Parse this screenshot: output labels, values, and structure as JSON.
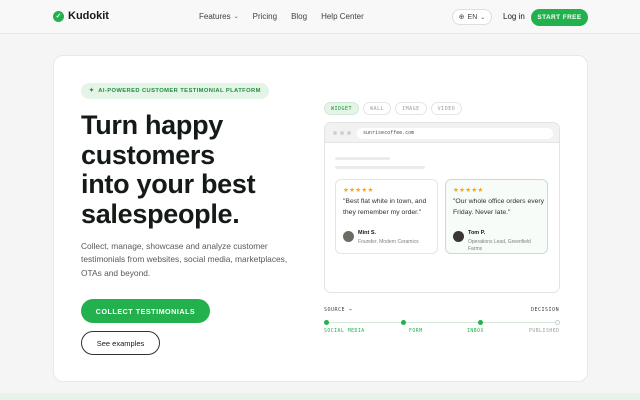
{
  "nav": {
    "logo": "Kudokit",
    "links": [
      "Features",
      "Pricing",
      "Blog",
      "Help Center"
    ],
    "lang": "EN",
    "login": "Log in",
    "start": "START FREE"
  },
  "hero": {
    "badge": "AI-POWERED CUSTOMER TESTIMONIAL PLATFORM",
    "headline": [
      "Turn happy",
      "customers",
      "into your best",
      "salespeople."
    ],
    "subtitle": "Collect, manage, showcase and analyze customer testimonials from websites, social media, marketplaces, OTAs and beyond.",
    "cta": "COLLECT TESTIMONIALS",
    "secondary": "See examples"
  },
  "preview": {
    "tabs": [
      "WIDGET",
      "WALL",
      "IMAGE",
      "VIDEO"
    ],
    "active_tab": "WIDGET",
    "url": "sunrisecoffee.com",
    "reviews": [
      {
        "stars": "★★★★★",
        "quote": "\"Best flat white in town, and they remember my order.\"",
        "name": "Mint S.",
        "role": "Founder, Modern Ceramics"
      },
      {
        "stars": "★★★★★",
        "quote": "\"Our whole office orders every Friday. Never late.\"",
        "name": "Tom P.",
        "role": "Operations Lead, Greenfield Farms"
      }
    ]
  },
  "flow": {
    "source": "SOURCE →",
    "decision": "DECISION",
    "steps": [
      "SOCIAL MEDIA",
      "FORM",
      "INBOX",
      "PUBLISHED"
    ]
  },
  "colors": {
    "accent": "#22b14c",
    "star": "#f2a51a"
  }
}
